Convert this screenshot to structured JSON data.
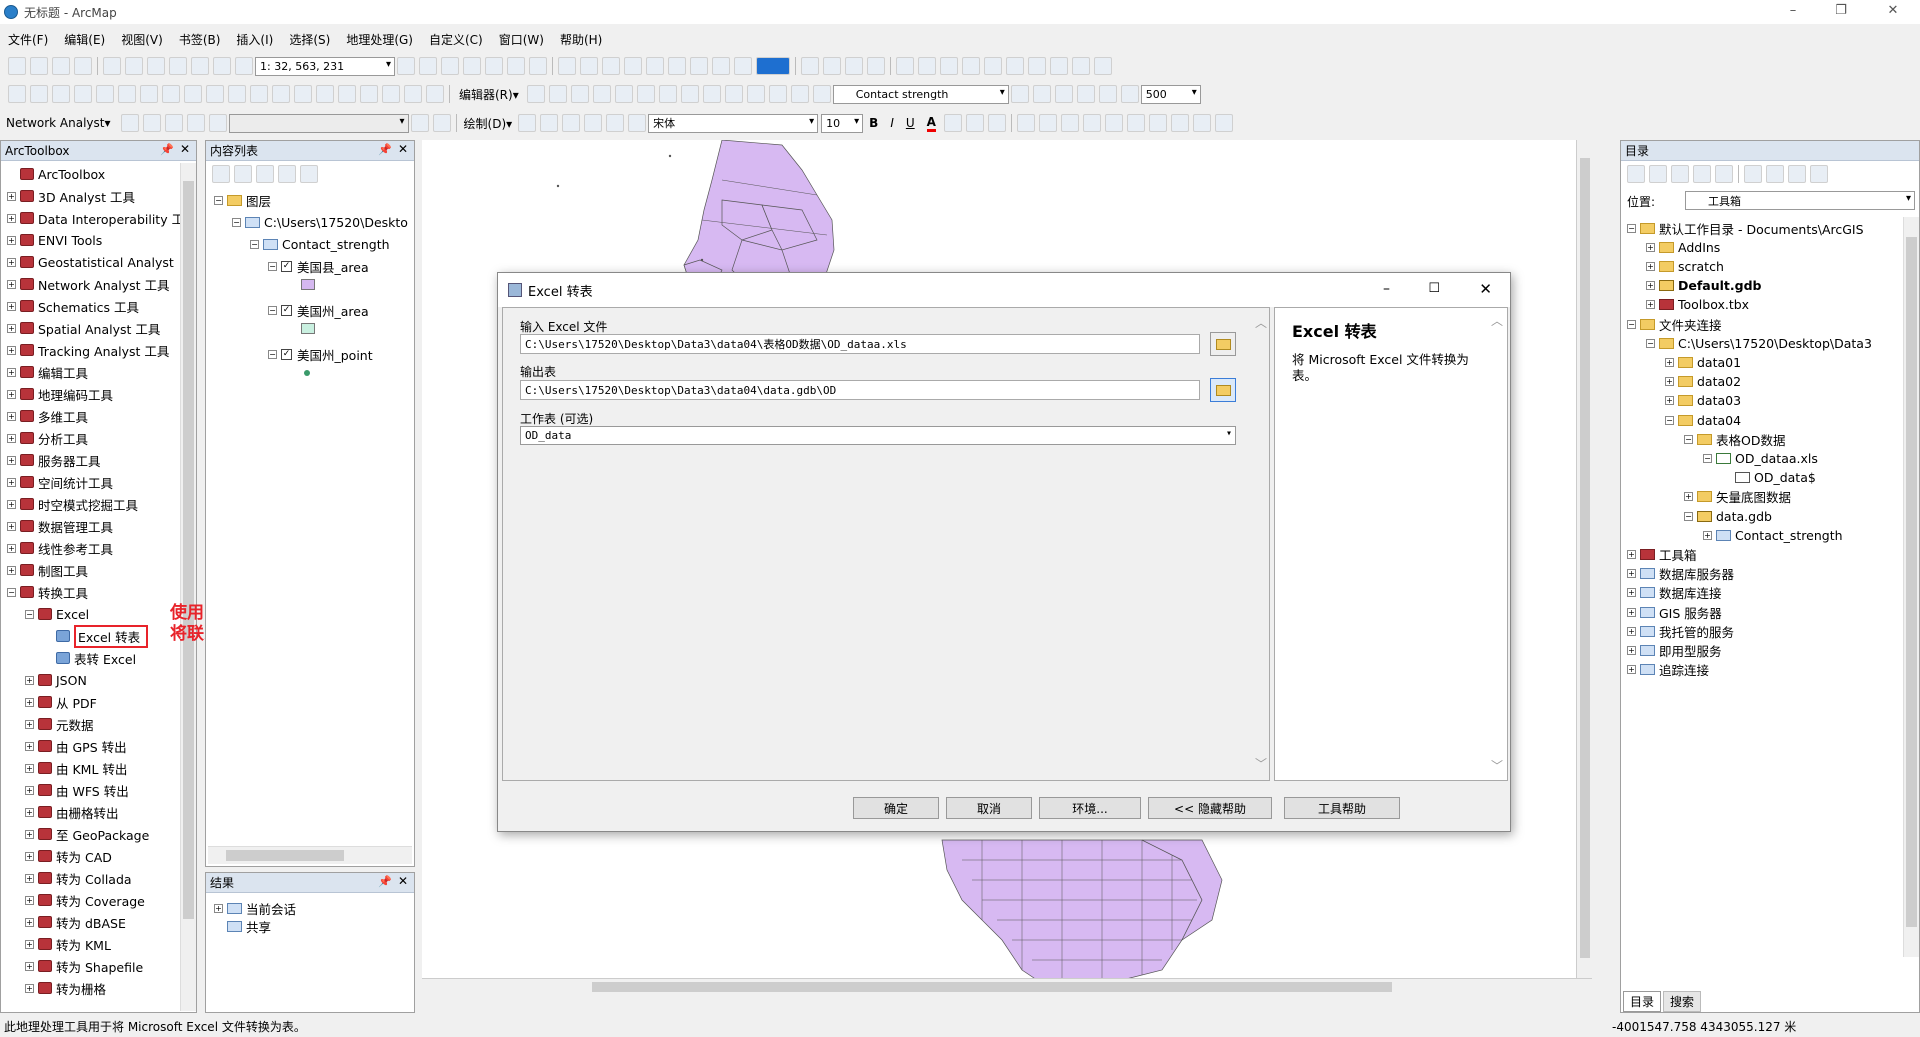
{
  "window": {
    "title": "无标题 - ArcMap",
    "minimize": "–",
    "restore": "❐",
    "close": "✕"
  },
  "menu": [
    "文件(F)",
    "编辑(E)",
    "视图(V)",
    "书签(B)",
    "插入(I)",
    "选择(S)",
    "地理处理(G)",
    "自定义(C)",
    "窗口(W)",
    "帮助(H)"
  ],
  "toolbar": {
    "scale": "1: 32, 563, 231",
    "editor": "编辑器(R)▾",
    "layer_combo": "Contact strength",
    "zoom_value": "500",
    "network_analyst": "Network Analyst▾",
    "draw": "绘制(D)▾",
    "font": "宋体",
    "font_size": "10",
    "bold": "B",
    "italic": "I",
    "underline": "U",
    "fontcolor": "A"
  },
  "arctoolbox": {
    "title": "ArcToolbox",
    "items": [
      {
        "label": "ArcToolbox",
        "level": 0,
        "exp": ""
      },
      {
        "label": "3D Analyst 工具",
        "level": 0,
        "exp": "+"
      },
      {
        "label": "Data Interoperability 工",
        "level": 0,
        "exp": "+"
      },
      {
        "label": "ENVI Tools",
        "level": 0,
        "exp": "+"
      },
      {
        "label": "Geostatistical Analyst",
        "level": 0,
        "exp": "+"
      },
      {
        "label": "Network Analyst 工具",
        "level": 0,
        "exp": "+"
      },
      {
        "label": "Schematics 工具",
        "level": 0,
        "exp": "+"
      },
      {
        "label": "Spatial Analyst 工具",
        "level": 0,
        "exp": "+"
      },
      {
        "label": "Tracking Analyst 工具",
        "level": 0,
        "exp": "+"
      },
      {
        "label": "编辑工具",
        "level": 0,
        "exp": "+"
      },
      {
        "label": "地理编码工具",
        "level": 0,
        "exp": "+"
      },
      {
        "label": "多维工具",
        "level": 0,
        "exp": "+"
      },
      {
        "label": "分析工具",
        "level": 0,
        "exp": "+"
      },
      {
        "label": "服务器工具",
        "level": 0,
        "exp": "+"
      },
      {
        "label": "空间统计工具",
        "level": 0,
        "exp": "+"
      },
      {
        "label": "时空模式挖掘工具",
        "level": 0,
        "exp": "+"
      },
      {
        "label": "数据管理工具",
        "level": 0,
        "exp": "+"
      },
      {
        "label": "线性参考工具",
        "level": 0,
        "exp": "+"
      },
      {
        "label": "制图工具",
        "level": 0,
        "exp": "+"
      },
      {
        "label": "转换工具",
        "level": 0,
        "exp": "−"
      },
      {
        "label": "Excel",
        "level": 1,
        "exp": "−"
      },
      {
        "label": "Excel 转表",
        "level": 2,
        "exp": "",
        "selected": true
      },
      {
        "label": "表转 Excel",
        "level": 2,
        "exp": ""
      },
      {
        "label": "JSON",
        "level": 1,
        "exp": "+"
      },
      {
        "label": "从 PDF",
        "level": 1,
        "exp": "+"
      },
      {
        "label": "元数据",
        "level": 1,
        "exp": "+"
      },
      {
        "label": "由 GPS 转出",
        "level": 1,
        "exp": "+"
      },
      {
        "label": "由 KML 转出",
        "level": 1,
        "exp": "+"
      },
      {
        "label": "由 WFS 转出",
        "level": 1,
        "exp": "+"
      },
      {
        "label": "由栅格转出",
        "level": 1,
        "exp": "+"
      },
      {
        "label": "至 GeoPackage",
        "level": 1,
        "exp": "+"
      },
      {
        "label": "转为 CAD",
        "level": 1,
        "exp": "+"
      },
      {
        "label": "转为 Collada",
        "level": 1,
        "exp": "+"
      },
      {
        "label": "转为 Coverage",
        "level": 1,
        "exp": "+"
      },
      {
        "label": "转为 dBASE",
        "level": 1,
        "exp": "+"
      },
      {
        "label": "转为 KML",
        "level": 1,
        "exp": "+"
      },
      {
        "label": "转为 Shapefile",
        "level": 1,
        "exp": "+"
      },
      {
        "label": "转为栅格",
        "level": 1,
        "exp": "+"
      }
    ]
  },
  "annotation": {
    "line1": "使用Excel转表方法，",
    "line2": "将联系强度数据变为表",
    "color": "#e8232a"
  },
  "toc": {
    "title": "内容列表",
    "layers_root": "图层",
    "path": "C:\\Users\\17520\\Deskto",
    "group": "Contact_strength",
    "layers": [
      {
        "name": "美国县_area",
        "color": "#d5b8f0",
        "sym": "poly"
      },
      {
        "name": "美国州_area",
        "color": "#c9f0e0",
        "sym": "poly"
      },
      {
        "name": "美国州_point",
        "color": "#3a9a6a",
        "sym": "point"
      }
    ]
  },
  "results": {
    "title": "结果",
    "items": [
      "当前会话",
      "共享"
    ]
  },
  "dialog": {
    "title": "Excel 转表",
    "input_label": "输入 Excel 文件",
    "input_value": "C:\\Users\\17520\\Desktop\\Data3\\data04\\表格OD数据\\OD_dataa.xls",
    "output_label": "输出表",
    "output_value": "C:\\Users\\17520\\Desktop\\Data3\\data04\\data.gdb\\OD",
    "sheet_label": "工作表 (可选)",
    "sheet_value": "OD_data",
    "help_title": "Excel 转表",
    "help_text": "将 Microsoft Excel 文件转换为表。",
    "buttons": {
      "ok": "确定",
      "cancel": "取消",
      "env": "环境...",
      "hide_help": "<< 隐藏帮助",
      "tool_help": "工具帮助"
    }
  },
  "catalog": {
    "title": "目录",
    "location_label": "位置:",
    "location_value": "工具箱",
    "items": [
      {
        "label": "默认工作目录 - Documents\\ArcGIS",
        "level": 0,
        "exp": "−",
        "icon": "fold"
      },
      {
        "label": "AddIns",
        "level": 1,
        "exp": "+",
        "icon": "fold"
      },
      {
        "label": "scratch",
        "level": 1,
        "exp": "+",
        "icon": "fold"
      },
      {
        "label": "Default.gdb",
        "level": 1,
        "exp": "+",
        "icon": "gdb",
        "bold": true
      },
      {
        "label": "Toolbox.tbx",
        "level": 1,
        "exp": "+",
        "icon": "tbx"
      },
      {
        "label": "文件夹连接",
        "level": 0,
        "exp": "−",
        "icon": "fold"
      },
      {
        "label": "C:\\Users\\17520\\Desktop\\Data3",
        "level": 1,
        "exp": "−",
        "icon": "fold"
      },
      {
        "label": "data01",
        "level": 2,
        "exp": "+",
        "icon": "fold"
      },
      {
        "label": "data02",
        "level": 2,
        "exp": "+",
        "icon": "fold"
      },
      {
        "label": "data03",
        "level": 2,
        "exp": "+",
        "icon": "fold"
      },
      {
        "label": "data04",
        "level": 2,
        "exp": "−",
        "icon": "fold"
      },
      {
        "label": "表格OD数据",
        "level": 3,
        "exp": "−",
        "icon": "fold"
      },
      {
        "label": "OD_dataa.xls",
        "level": 4,
        "exp": "−",
        "icon": "xls"
      },
      {
        "label": "OD_data$",
        "level": 5,
        "exp": "",
        "icon": "table"
      },
      {
        "label": "矢量底图数据",
        "level": 3,
        "exp": "+",
        "icon": "fold"
      },
      {
        "label": "data.gdb",
        "level": 3,
        "exp": "−",
        "icon": "gdb"
      },
      {
        "label": "Contact_strength",
        "level": 4,
        "exp": "+",
        "icon": "fds"
      },
      {
        "label": "工具箱",
        "level": 0,
        "exp": "+",
        "icon": "tbx"
      },
      {
        "label": "数据库服务器",
        "level": 0,
        "exp": "+",
        "icon": "srv"
      },
      {
        "label": "数据库连接",
        "level": 0,
        "exp": "+",
        "icon": "srv"
      },
      {
        "label": "GIS 服务器",
        "level": 0,
        "exp": "+",
        "icon": "srv"
      },
      {
        "label": "我托管的服务",
        "level": 0,
        "exp": "+",
        "icon": "srv"
      },
      {
        "label": "即用型服务",
        "level": 0,
        "exp": "+",
        "icon": "srv"
      },
      {
        "label": "追踪连接",
        "level": 0,
        "exp": "+",
        "icon": "srv"
      }
    ],
    "tab_catalog": "目录",
    "tab_search": "搜索"
  },
  "status": {
    "message": "此地理处理工具用于将 Microsoft Excel 文件转换为表。",
    "coords": "-4001547.758  4343055.127 米"
  },
  "colors": {
    "map_fill": "#d7b9f2",
    "map_stroke": "#555",
    "panel_header": "#dbe4ef"
  }
}
